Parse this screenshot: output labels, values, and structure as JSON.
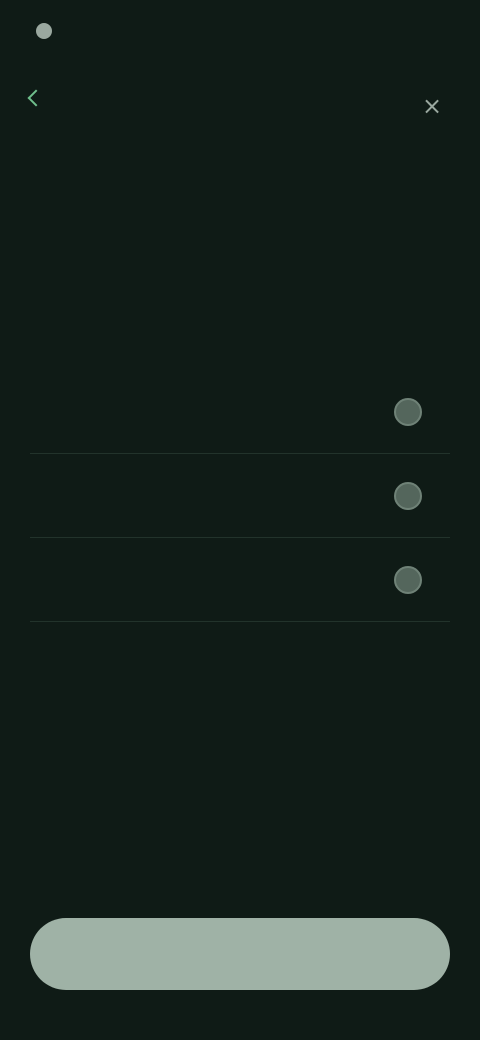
{
  "status_bar": {
    "time": "",
    "indicators": ""
  },
  "top_bar": {
    "back_label": "",
    "close_glyph": "×"
  },
  "page": {
    "title": "",
    "subtitle": ""
  },
  "options": [
    {
      "label": "",
      "selected": false
    },
    {
      "label": "",
      "selected": false
    },
    {
      "label": "",
      "selected": false
    }
  ],
  "footnote": "",
  "continue_button": {
    "label": ""
  },
  "colors": {
    "background": "#0f1b16",
    "accent": "#6fbf8c",
    "button": "#9fb2a6",
    "radio": "#54665c"
  }
}
